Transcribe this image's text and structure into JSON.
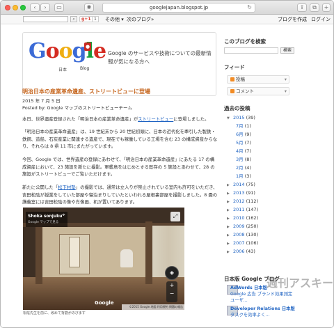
{
  "browser": {
    "url": "googlejapan.blogspot.jp"
  },
  "navbar": {
    "gplus_label": "g+1",
    "gplus_count": "1",
    "more_label": "その他 ▾",
    "next_blog_label": "次のブログ»",
    "create_blog_label": "ブログを作成",
    "login_label": "ログイン"
  },
  "header": {
    "logo_text": "Google",
    "logo_sub_jp": "日本",
    "logo_sub_blog": "Blog",
    "tagline": "Google のサービスや技術についての最新情報が気になる方へ"
  },
  "post": {
    "title": "明治日本の産業革命遺産、ストリートビューに登場",
    "date": "2015 年 7 月 5 日",
    "author": "Posted by: Google マップのストリートビューチーム",
    "p1_a": "本日、世界遺産登録された「明治日本の産業革命遺産」が",
    "p1_link": "ストリートビュー",
    "p1_b": "に登場しました。",
    "p2": "「明治日本の産業革命遺産」は、19 世紀末から 20 世紀初頭に、日本の近代化を牽引した製鉄・鉄鋼、造船、石炭産業に関連する遺産で、現在でも稼働している工場を含む 23 の構成資産からなり、それらは 8 県 11 市にまたがっています。",
    "p3": "今回、Google では、世界遺産の登録にあわせて、「明治日本の産業革命遺産」にあたる 17 の構成資産において、23 施設を新たに撮影。軍艦島をはじめとする既存の 5 施設とあわせて、28 の施設がストリートビューでご覧いただけます。",
    "p4_a": "新たに公開した「",
    "p4_link": "松下村塾",
    "p4_b": "」の撮影では、通常は立入りが禁止されている室内も許可をいただき、吉田松陰が授業をしていた部屋や寝泊まりしていたといわれる屋根裏部屋を撮影しました。8 畳の講義室には吉田松陰の像や肖像画、机が置いてあります。",
    "streetview": {
      "label_title": "Shoka sonjuku",
      "label_sub": "Google マップで見る",
      "google": "Google",
      "footer": "©2015 Google   地図  利用規約  問題の報告",
      "caption": "松陰先生を前に、改めて背筋がのびます"
    }
  },
  "sidebar": {
    "search_title": "このブログを検索",
    "search_button": "検索",
    "feed_title": "フィード",
    "feed_posts": "投稿",
    "feed_comments": "コメント",
    "archive_title": "過去の投稿",
    "archive": [
      {
        "label": "2015",
        "count": "(39)",
        "expanded": true
      },
      {
        "label": "7月",
        "count": "(1)",
        "sub": true
      },
      {
        "label": "6月",
        "count": "(9)",
        "sub": true
      },
      {
        "label": "5月",
        "count": "(7)",
        "sub": true
      },
      {
        "label": "4月",
        "count": "(7)",
        "sub": true
      },
      {
        "label": "3月",
        "count": "(8)",
        "sub": true
      },
      {
        "label": "2月",
        "count": "(4)",
        "sub": true
      },
      {
        "label": "1月",
        "count": "(3)",
        "sub": true
      },
      {
        "label": "2014",
        "count": "(75)"
      },
      {
        "label": "2013",
        "count": "(91)"
      },
      {
        "label": "2012",
        "count": "(112)"
      },
      {
        "label": "2011",
        "count": "(147)"
      },
      {
        "label": "2010",
        "count": "(162)"
      },
      {
        "label": "2009",
        "count": "(250)"
      },
      {
        "label": "2008",
        "count": "(130)"
      },
      {
        "label": "2007",
        "count": "(106)"
      },
      {
        "label": "2006",
        "count": "(43)"
      }
    ],
    "blogs_title": "日本版 Google ブログ",
    "blogs": [
      {
        "name": "AdWords 日本版",
        "desc": "Google 広告 ブランド効果測定"
      },
      {
        "name": "",
        "desc": "ユーザ..."
      },
      {
        "name": "Developer Relations 日本版",
        "desc": "タスクを効率よく..."
      }
    ]
  },
  "watermark": "週刊アスキー",
  "colors": {
    "title_orange": "#c5641b",
    "link_blue": "#1d62c2"
  }
}
